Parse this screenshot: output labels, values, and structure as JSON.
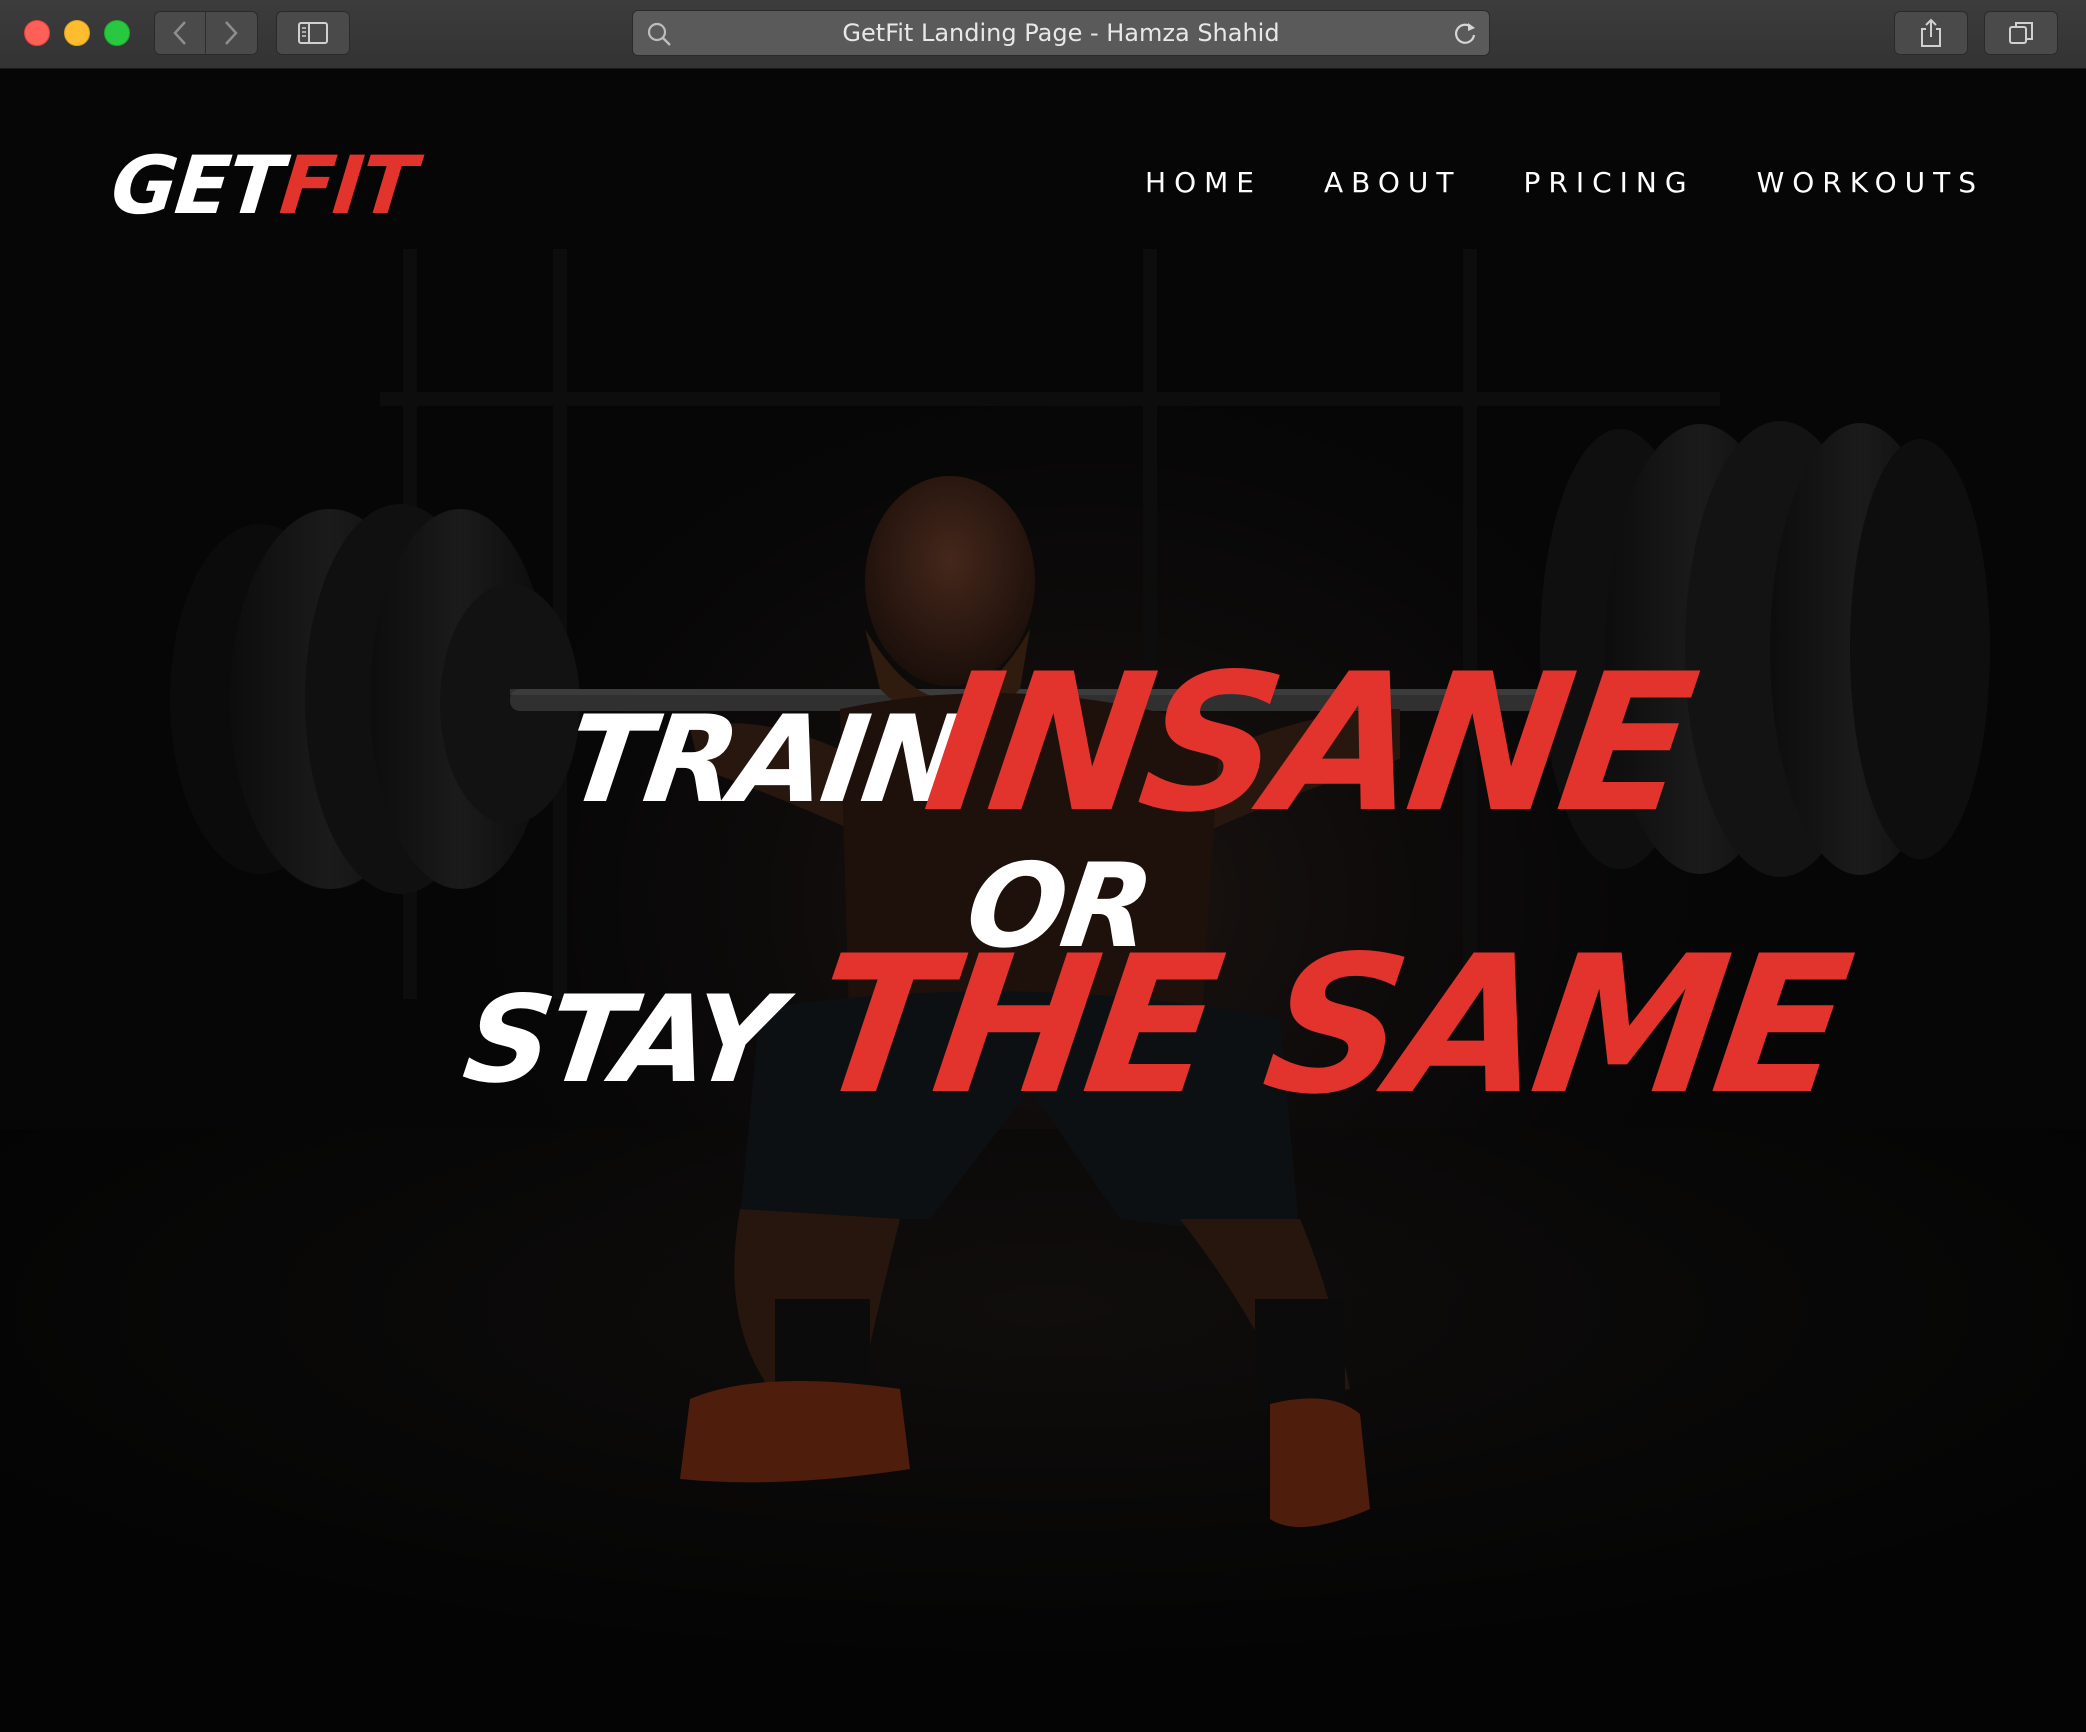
{
  "browser": {
    "page_title": "GetFit Landing Page - Hamza Shahid",
    "icons": {
      "back": "chevron-left-icon",
      "forward": "chevron-right-icon",
      "sidebar": "sidebar-icon",
      "search": "search-icon",
      "reload": "reload-icon",
      "share": "share-icon",
      "tabs": "tabs-icon"
    }
  },
  "site": {
    "logo": {
      "part1": "GET",
      "part2": "FIT"
    },
    "nav": {
      "items": [
        {
          "label": "HOME"
        },
        {
          "label": "ABOUT"
        },
        {
          "label": "PRICING"
        },
        {
          "label": "WORKOUTS"
        }
      ]
    },
    "hero": {
      "line1_white": "TRAIN",
      "line1_red": "INSANE",
      "middle": "OR",
      "line2_white": "STAY",
      "line2_red": "THE SAME"
    }
  },
  "colors": {
    "accent": "#e2332c",
    "text": "#ffffff",
    "background": "#050505",
    "chrome": "#3a3a3a"
  }
}
